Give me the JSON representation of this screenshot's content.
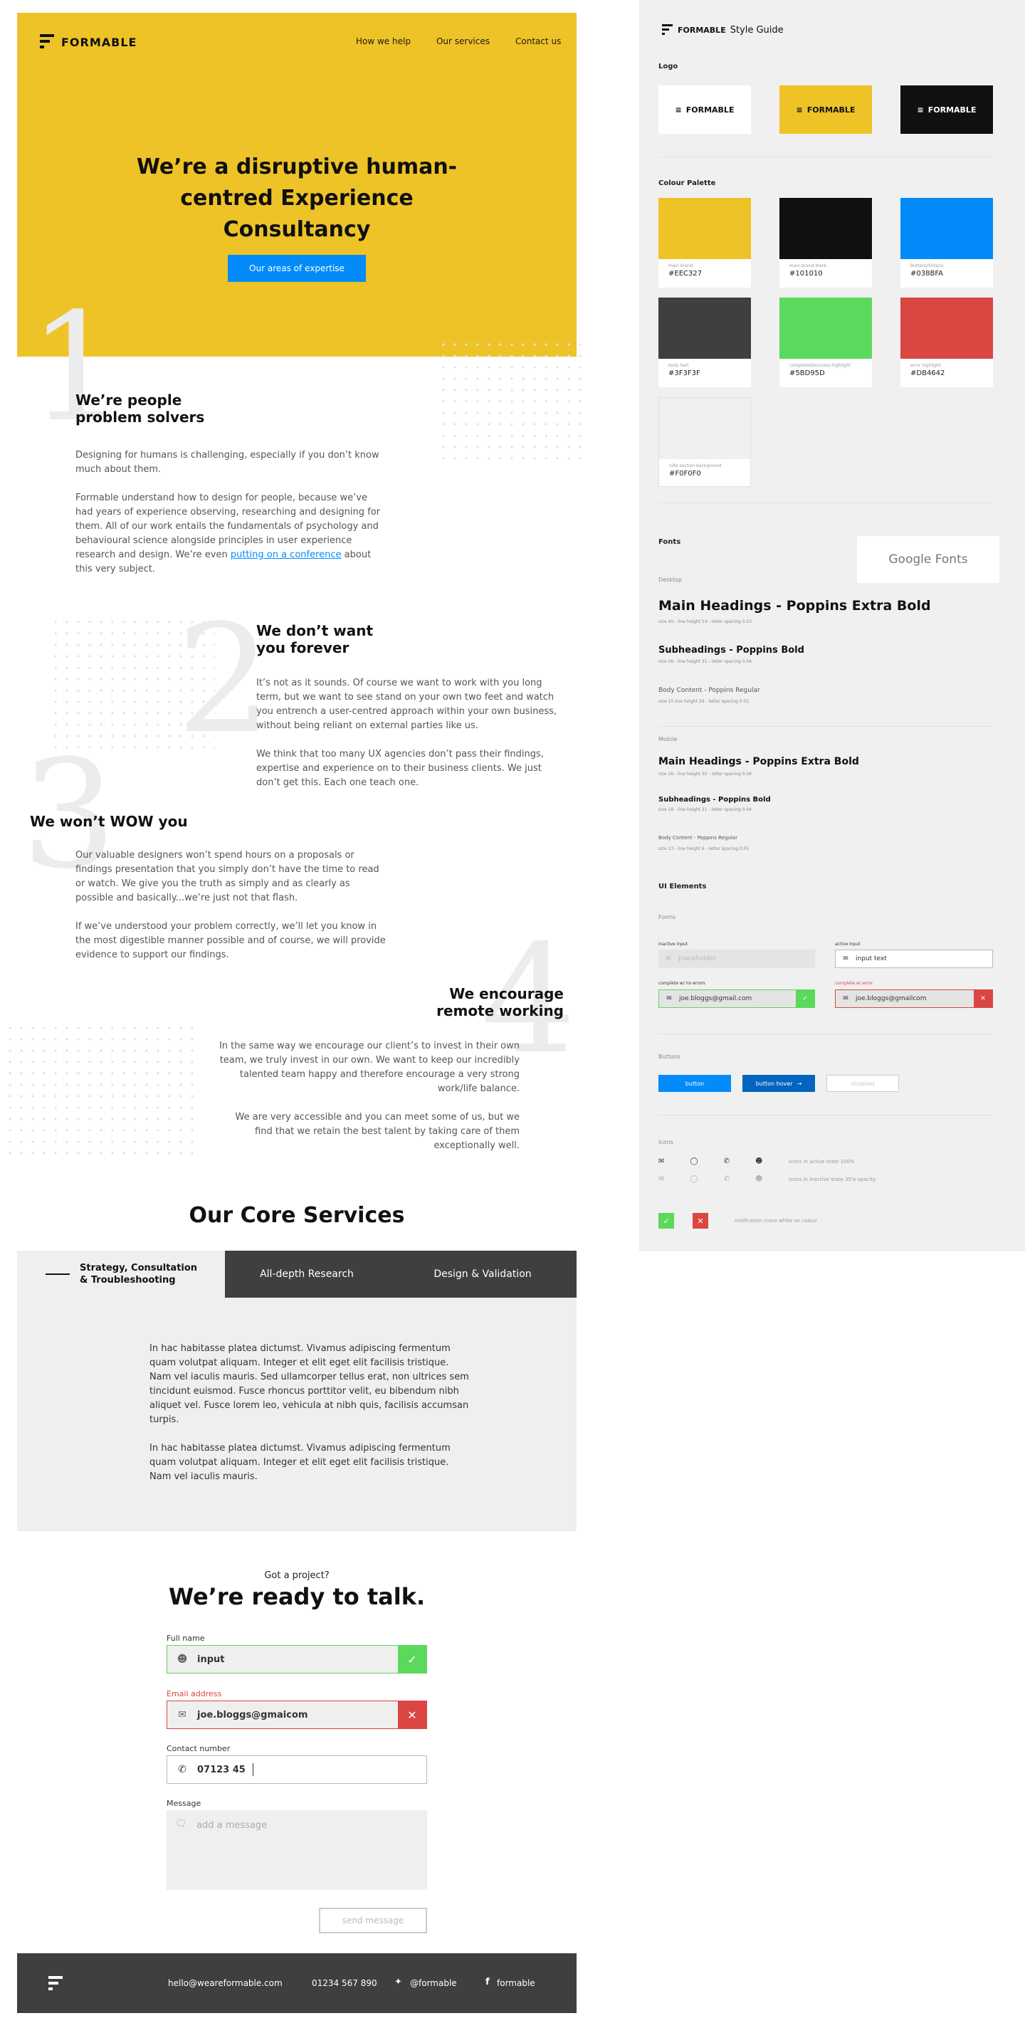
{
  "brand": {
    "name": "FORMABLE",
    "yellow": "#EEC327",
    "black": "#101010",
    "blue": "#038BFA",
    "dark_grey": "#3F3F3F",
    "green": "#5BD95D",
    "red": "#DB4642",
    "light_grey": "#F0F0F0"
  },
  "nav": {
    "items": [
      "How we help",
      "Our services",
      "Contact us"
    ]
  },
  "hero": {
    "title": "We’re a disruptive human-centred Experience Consultancy",
    "button": "Our areas of expertise"
  },
  "sections": [
    {
      "number": "1",
      "title_line1": "We’re people",
      "title_line2": "problem solvers",
      "p1": "Designing for humans is challenging, especially if you don’t know much about them.",
      "p2_before": "Formable understand how to design for people, because we’ve had years of experience observing, researching and designing for them. All of our work entails the fundamentals of psychology and behavioural science alongside principles in user experience research and design. We’re even ",
      "p2_link": "putting on a conference",
      "p2_after": " about this very subject."
    },
    {
      "number": "2",
      "title_line1": "We don’t want",
      "title_line2": "you forever",
      "p1": "It’s not as it sounds. Of course we want to work with you long term, but we want to see stand on your own two feet and watch you entrench a user-centred approach within your own business, without being reliant on external parties like us.",
      "p2": "We think that too many UX agencies don’t pass their findings, expertise and experience on to their business clients. We just don’t get this. Each one teach one."
    },
    {
      "number": "3",
      "title": "We won’t WOW you",
      "p1": "Our valuable designers won’t spend hours on a proposals or findings presentation that you simply don’t have the time to read or watch. We give you the truth as simply and as clearly as possible and basically...we’re just not that flash.",
      "p2": "If we’ve understood your problem correctly, we’ll let you know in the most digestible manner possible and of course, we will provide evidence to support our findings."
    },
    {
      "number": "4",
      "title_line1": "We encourage",
      "title_line2": "remote working",
      "p1": "In the same way we encourage our client’s to invest in their own team, we truly invest in our own. We want to keep our incredibly talented team happy and therefore encourage a very strong work/life balance.",
      "p2": "We are very accessible and you can meet some of us, but we find that we retain the best talent by taking care of them exceptionally well."
    }
  ],
  "services": {
    "title": "Our Core Services",
    "tabs": [
      "Strategy, Consultation & Troubleshooting",
      "All-depth Research",
      "Design & Validation"
    ],
    "p1": "In hac habitasse platea dictumst. Vivamus adipiscing fermentum quam volutpat aliquam. Integer et elit eget elit facilisis tristique. Nam vel iaculis mauris. Sed ullamcorper tellus erat, non ultrices sem tincidunt euismod. Fusce rhoncus porttitor velit, eu bibendum nibh aliquet vel. Fusce lorem leo, vehicula at nibh quis, facilisis accumsan turpis.",
    "p2": "In hac habitasse platea dictumst. Vivamus adipiscing fermentum quam volutpat aliquam. Integer et elit eget elit facilisis tristique. Nam vel iaculis mauris."
  },
  "contact": {
    "subtitle": "Got a project?",
    "title": "We’re ready to talk.",
    "name_label": "Full name",
    "name_value": "input",
    "email_label": "Email address",
    "email_value": "joe.bloggs@gmaicom",
    "phone_label": "Contact number",
    "phone_value": "07123 45",
    "message_label": "Message",
    "message_placeholder": "add a message",
    "send": "send message"
  },
  "footer": {
    "email": "hello@weareformable.com",
    "phone": "01234 567 890",
    "twitter": "@formable",
    "facebook": "formable"
  },
  "style_guide": {
    "title_brand": "FORMABLE",
    "title_rest": "Style Guide",
    "logo_heading": "Logo",
    "palette_heading": "Colour Palette",
    "swatches": [
      {
        "label": "main brand",
        "hex": "#EEC327",
        "color": "#EEC327"
      },
      {
        "label": "main brand black",
        "hex": "#101010",
        "color": "#101010"
      },
      {
        "label": "Buttons/links/ui",
        "hex": "#038BFA",
        "color": "#038BFA"
      },
      {
        "label": "body text",
        "hex": "#3F3F3F",
        "color": "#3F3F3F"
      },
      {
        "label": "completed/success highlight",
        "hex": "#5BD95D",
        "color": "#5BD95D"
      },
      {
        "label": "error highlight",
        "hex": "#DB4642",
        "color": "#DB4642"
      },
      {
        "label": "ciite section background",
        "hex": "#F0F0F0",
        "color": "#F0F0F0"
      }
    ],
    "fonts_heading": "Fonts",
    "google_fonts": "Google Fonts",
    "desktop": "Desktop",
    "mobile": "Mobile",
    "d_h1": "Main Headings - Poppins Extra Bold",
    "d_h1_spec": "size 40 - line height 54 - letter spacing 0.03",
    "d_h2": "Subheadings - Poppins Bold",
    "d_h2_spec": "size 26 - line height 31 - letter spacing 0.04",
    "d_body": "Body Content - Poppins Regular",
    "d_body_spec": "size 15 line height 26 - letter spacing 0.02",
    "m_h1": "Main Headings - Poppins Extra Bold",
    "m_h1_spec": "size 26 - line height 30 - letter spacing 0.04",
    "m_h2": "Subheadings - Poppins Bold",
    "m_h2_spec": "size 18 - line height 21 - letter spacing 0.04",
    "m_body": "Body Content - Poppins Regular",
    "m_body_spec": "size 13 - line height 6 - letter spacing 0.05",
    "ui_heading": "UI Elements",
    "forms": "Forms",
    "inactive_label": "inactive input",
    "inactive_placeholder": "placeholder",
    "active_label": "active input",
    "active_value": "input text",
    "complete_label": "complete w/ no errors",
    "complete_value": "joe.bloggs@gmail.com",
    "error_label": "complete w/ error",
    "error_value": "joe.bloggs@gmailcom",
    "buttons_heading": "Buttons",
    "btn_default": "button",
    "btn_hover": "button hover",
    "btn_disabled": "disabled",
    "icons_heading": "Icons",
    "icons_active": "Icons in active state 100%",
    "icons_inactive": "Icons in inactive state 35% opacity",
    "notification_note": "notification icons white on colour"
  }
}
